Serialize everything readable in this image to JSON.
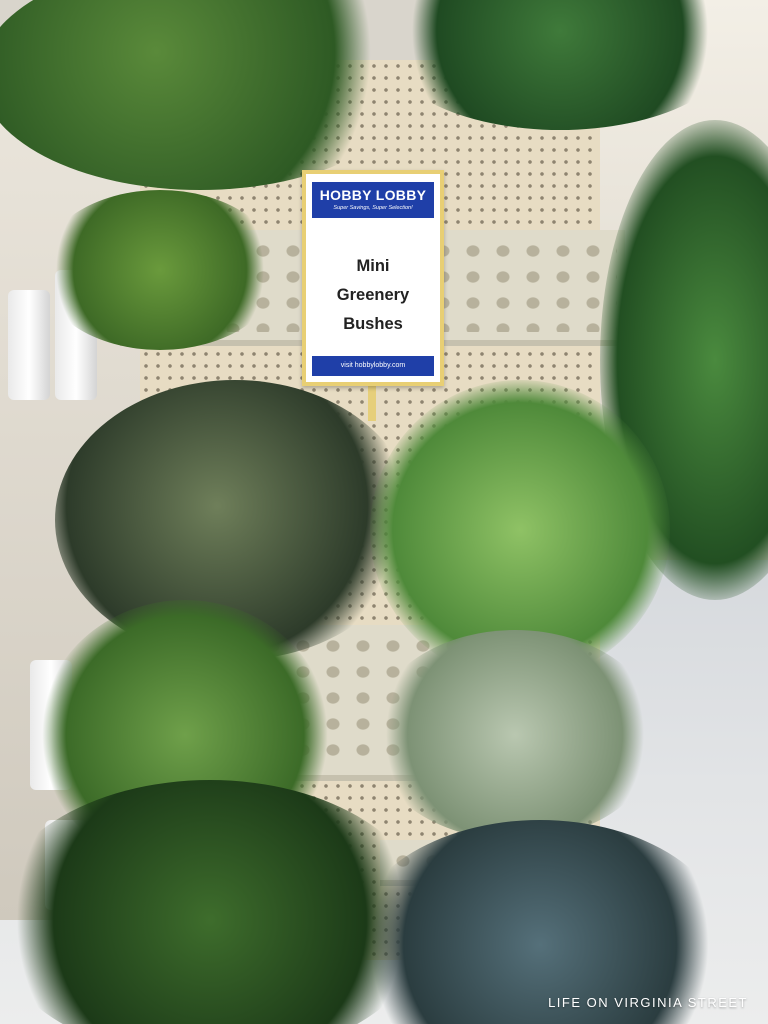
{
  "sign": {
    "brand": "HOBBY LOBBY",
    "tagline": "Super Savings, Super Selection!",
    "title_lines": [
      "Mini",
      "Greenery",
      "Bushes"
    ],
    "footer": "visit hobbylobby.com"
  },
  "watermark": "LIFE ON VIRGINIA STREET",
  "colors": {
    "sign_blue": "#1f3fa8",
    "sign_frame": "#e8cf74",
    "pegboard": "#e7dcc3"
  }
}
